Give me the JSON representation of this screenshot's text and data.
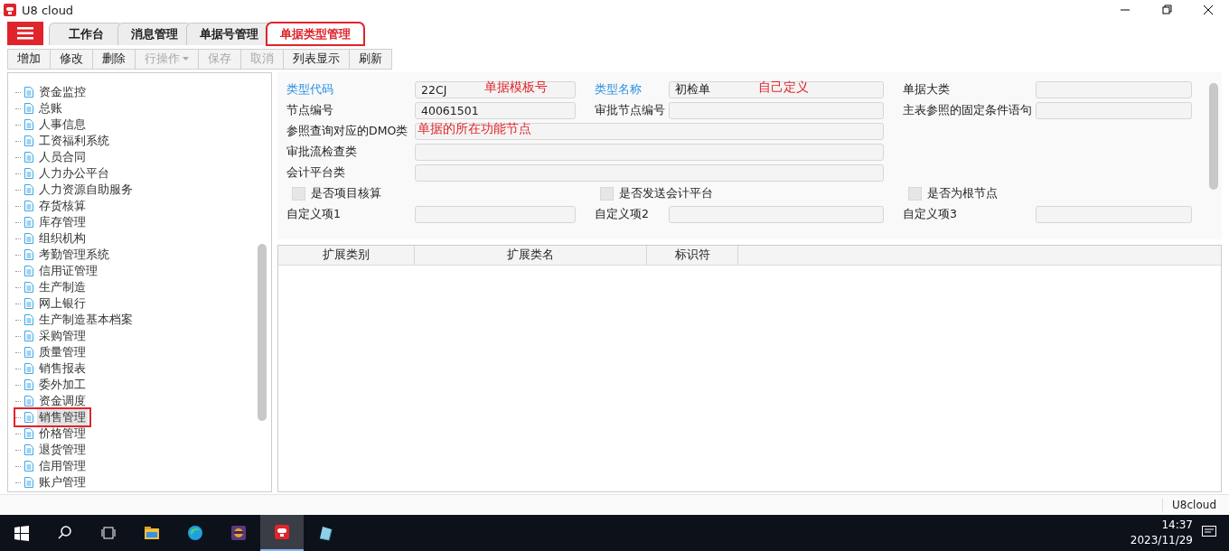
{
  "window": {
    "title": "U8 cloud"
  },
  "tabs": [
    {
      "label": "工作台",
      "selected": false,
      "annotated": false
    },
    {
      "label": "消息管理",
      "selected": false,
      "annotated": false
    },
    {
      "label": "单据号管理",
      "selected": false,
      "annotated": false
    },
    {
      "label": "单据类型管理",
      "selected": true,
      "annotated": true
    }
  ],
  "toolbar": [
    {
      "label": "增加",
      "disabled": false,
      "dropdown": false
    },
    {
      "label": "修改",
      "disabled": false,
      "dropdown": false
    },
    {
      "label": "删除",
      "disabled": false,
      "dropdown": false
    },
    {
      "label": "行操作",
      "disabled": true,
      "dropdown": true
    },
    {
      "label": "保存",
      "disabled": true,
      "dropdown": false
    },
    {
      "label": "取消",
      "disabled": true,
      "dropdown": false
    },
    {
      "label": "列表显示",
      "disabled": false,
      "dropdown": false
    },
    {
      "label": "刷新",
      "disabled": false,
      "dropdown": false
    }
  ],
  "tree": {
    "items": [
      {
        "label": "资金监控",
        "selected": false,
        "annotated": false
      },
      {
        "label": "总账",
        "selected": false,
        "annotated": false
      },
      {
        "label": "人事信息",
        "selected": false,
        "annotated": false
      },
      {
        "label": "工资福利系统",
        "selected": false,
        "annotated": false
      },
      {
        "label": "人员合同",
        "selected": false,
        "annotated": false
      },
      {
        "label": "人力办公平台",
        "selected": false,
        "annotated": false
      },
      {
        "label": "人力资源自助服务",
        "selected": false,
        "annotated": false
      },
      {
        "label": "存货核算",
        "selected": false,
        "annotated": false
      },
      {
        "label": "库存管理",
        "selected": false,
        "annotated": false
      },
      {
        "label": "组织机构",
        "selected": false,
        "annotated": false
      },
      {
        "label": "考勤管理系统",
        "selected": false,
        "annotated": false
      },
      {
        "label": "信用证管理",
        "selected": false,
        "annotated": false
      },
      {
        "label": "生产制造",
        "selected": false,
        "annotated": false
      },
      {
        "label": "网上银行",
        "selected": false,
        "annotated": false
      },
      {
        "label": "生产制造基本档案",
        "selected": false,
        "annotated": false
      },
      {
        "label": "采购管理",
        "selected": false,
        "annotated": false
      },
      {
        "label": "质量管理",
        "selected": false,
        "annotated": false
      },
      {
        "label": "销售报表",
        "selected": false,
        "annotated": false
      },
      {
        "label": "委外加工",
        "selected": false,
        "annotated": false
      },
      {
        "label": "资金调度",
        "selected": false,
        "annotated": false
      },
      {
        "label": "销售管理",
        "selected": true,
        "annotated": true
      },
      {
        "label": "价格管理",
        "selected": false,
        "annotated": false
      },
      {
        "label": "退货管理",
        "selected": false,
        "annotated": false
      },
      {
        "label": "信用管理",
        "selected": false,
        "annotated": false
      },
      {
        "label": "账户管理",
        "selected": false,
        "annotated": false
      }
    ]
  },
  "form": {
    "rows": [
      [
        {
          "kind": "text",
          "label": "类型代码",
          "required": true,
          "value": "22CJ",
          "annotation": "单据模板号"
        },
        {
          "kind": "text",
          "label": "类型名称",
          "required": true,
          "value": "初检单",
          "annotation": "自己定义"
        },
        {
          "kind": "text",
          "label": "单据大类",
          "required": false
        }
      ],
      [
        {
          "kind": "text",
          "label": "节点编号",
          "required": false,
          "value": "40061501"
        },
        {
          "kind": "text",
          "label": "审批节点编号",
          "required": false
        },
        {
          "kind": "text",
          "label": "主表参照的固定条件语句",
          "required": false
        }
      ],
      [
        {
          "kind": "wide",
          "label": "参照查询对应的DMO类",
          "required": false,
          "annotation": "单据的所在功能节点"
        }
      ],
      [
        {
          "kind": "wide",
          "label": "审批流检查类",
          "required": false
        }
      ],
      [
        {
          "kind": "wide",
          "label": "会计平台类",
          "required": false
        }
      ],
      [
        {
          "kind": "check",
          "label": "是否项目核算",
          "checked": false
        },
        {
          "kind": "check",
          "label": "是否发送会计平台",
          "checked": false
        },
        {
          "kind": "check",
          "label": "是否为根节点",
          "checked": false
        }
      ],
      [
        {
          "kind": "text",
          "label": "自定义项1",
          "required": false
        },
        {
          "kind": "text",
          "label": "自定义项2",
          "required": false
        },
        {
          "kind": "text",
          "label": "自定义项3",
          "required": false
        }
      ]
    ]
  },
  "table": {
    "columns": [
      "扩展类别",
      "扩展类名",
      "标识符"
    ]
  },
  "status_bar": {
    "text": "U8cloud"
  },
  "taskbar": {
    "time": "14:37",
    "date": "2023/11/29"
  }
}
